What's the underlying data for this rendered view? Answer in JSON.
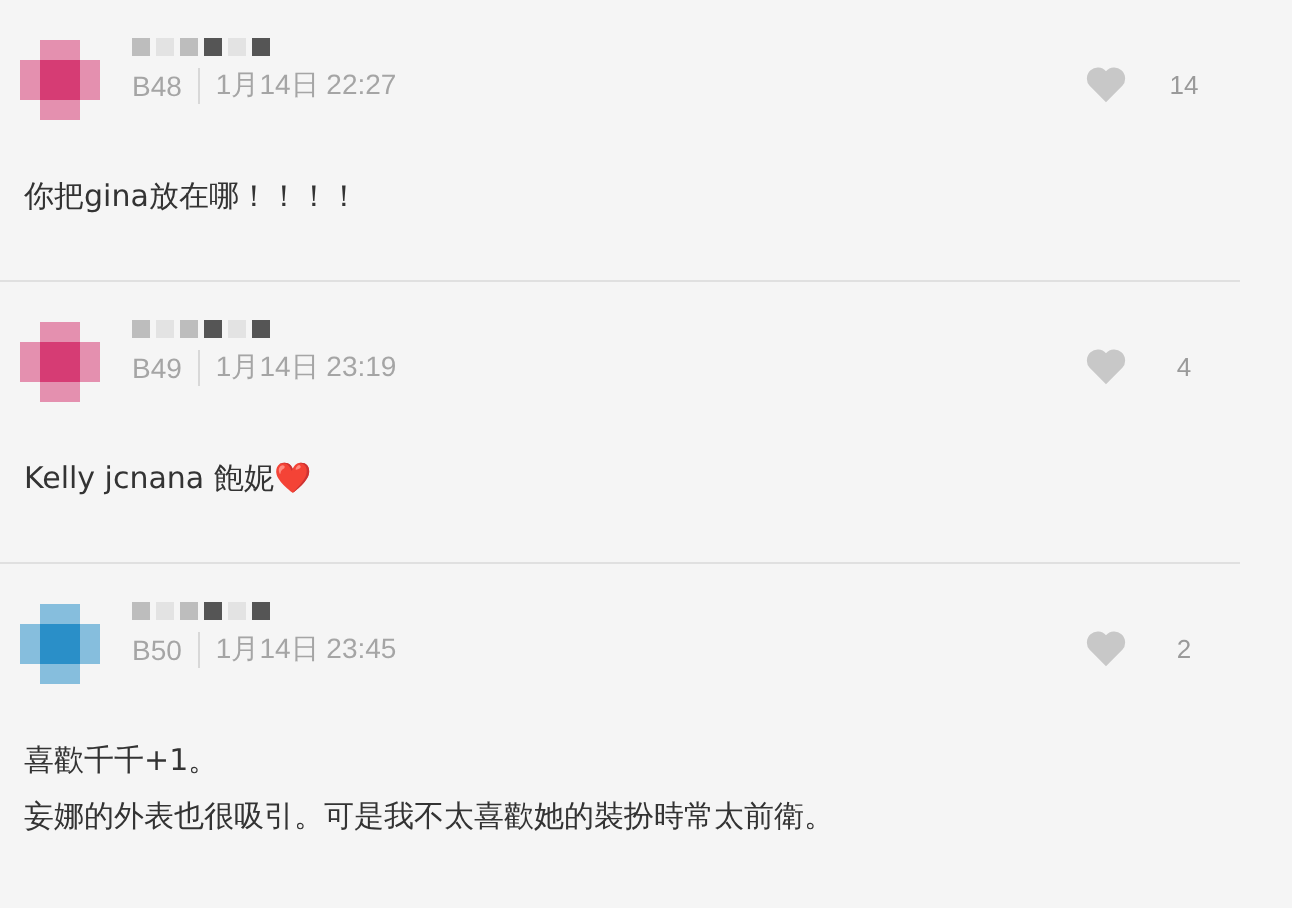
{
  "comments": [
    {
      "floor": "B48",
      "date": "1月14日 22:27",
      "likes": "14",
      "color": "#d63c74",
      "lines": [
        "你把gina放在哪！！！！"
      ]
    },
    {
      "floor": "B49",
      "date": "1月14日 23:19",
      "likes": "4",
      "color": "#d63c74",
      "lines": [
        "Kelly jcnana 飽妮❤️"
      ]
    },
    {
      "floor": "B50",
      "date": "1月14日 23:45",
      "likes": "2",
      "color": "#2a8fc8",
      "lines": [
        "喜歡千千+1。",
        "妄娜的外表也很吸引。可是我不太喜歡她的裝扮時常太前衛。"
      ]
    }
  ]
}
